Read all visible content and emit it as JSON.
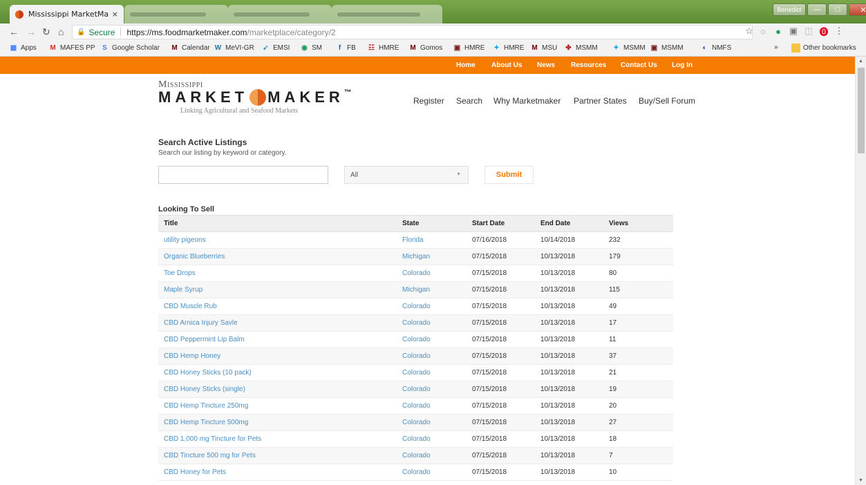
{
  "browser": {
    "active_tab_title": "Mississippi MarketMaker",
    "tab_close": "×",
    "user_button": "Benedict",
    "secure_label": "Secure",
    "url_host": "https://ms.foodmarketmaker.com",
    "url_path": "/marketplace/category/2",
    "bookmarks": [
      {
        "label": "Apps",
        "icon": "apps-grid-icon",
        "color": "#4285f4"
      },
      {
        "label": "MAFES PP",
        "icon": "gmail-icon",
        "color": "#d93025"
      },
      {
        "label": "Google Scholar",
        "icon": "scholar-icon",
        "color": "#4285f4"
      },
      {
        "label": "Calendar",
        "icon": "msu-m-icon",
        "color": "#660000"
      },
      {
        "label": "MeVI-GR",
        "icon": "wordpress-icon",
        "color": "#21759b"
      },
      {
        "label": "EMSI",
        "icon": "emsi-icon",
        "color": "#3aa0c8"
      },
      {
        "label": "SM",
        "icon": "sm-icon",
        "color": "#1a9b5a"
      },
      {
        "label": "FB",
        "icon": "facebook-icon",
        "color": "#3b5998"
      },
      {
        "label": "HMRE",
        "icon": "hmre-icon",
        "color": "#b22222"
      },
      {
        "label": "Gomos",
        "icon": "msu-m-icon",
        "color": "#660000"
      },
      {
        "label": "HMRE",
        "icon": "photo-icon",
        "color": "#7a1f1f"
      },
      {
        "label": "HMRE",
        "icon": "twitter-icon",
        "color": "#1da1f2"
      },
      {
        "label": "MSU",
        "icon": "msu-m-icon",
        "color": "#660000"
      },
      {
        "label": "MSMM",
        "icon": "msmm-icon",
        "color": "#b22222"
      },
      {
        "label": "MSMM",
        "icon": "twitter-icon",
        "color": "#1da1f2"
      },
      {
        "label": "MSMM",
        "icon": "photo-icon",
        "color": "#7a1f1f"
      },
      {
        "label": "NMFS",
        "icon": "noaa-icon",
        "color": "#1f4e9e"
      }
    ],
    "bookmarks_overflow": "»",
    "other_bookmarks": "Other bookmarks"
  },
  "topnav": [
    "Home",
    "About Us",
    "News",
    "Resources",
    "Contact Us",
    "Log In"
  ],
  "logo": {
    "line1": "Mississippi",
    "market": "MARKET",
    "maker": "MAKER",
    "tm": "™",
    "tagline": "Linking Agricultural and Seafood Markets"
  },
  "mainnav": [
    "Register",
    "Search",
    "Why Marketmaker",
    "Partner States",
    "Buy/Sell Forum"
  ],
  "search": {
    "title": "Search Active Listings",
    "subtitle": "Search our listing by keyword or category.",
    "input_value": "",
    "category_selected": "All",
    "submit_label": "Submit"
  },
  "listings": {
    "title": "Looking To Sell",
    "columns": [
      "Title",
      "State",
      "Start Date",
      "End Date",
      "Views"
    ],
    "rows": [
      [
        "utility pigeons",
        "Florida",
        "07/16/2018",
        "10/14/2018",
        "232"
      ],
      [
        "Organic Blueberries",
        "Michigan",
        "07/15/2018",
        "10/13/2018",
        "179"
      ],
      [
        "Toe Drops",
        "Colorado",
        "07/15/2018",
        "10/13/2018",
        "80"
      ],
      [
        "Maple Syrup",
        "Michigan",
        "07/15/2018",
        "10/13/2018",
        "115"
      ],
      [
        "CBD Muscle Rub",
        "Colorado",
        "07/15/2018",
        "10/13/2018",
        "49"
      ],
      [
        "CBD Arnica Injury Savle",
        "Colorado",
        "07/15/2018",
        "10/13/2018",
        "17"
      ],
      [
        "CBD Peppermint Lip Balm",
        "Colorado",
        "07/15/2018",
        "10/13/2018",
        "11"
      ],
      [
        "CBD Hemp Honey",
        "Colorado",
        "07/15/2018",
        "10/13/2018",
        "37"
      ],
      [
        "CBD Honey Sticks (10 pack)",
        "Colorado",
        "07/15/2018",
        "10/13/2018",
        "21"
      ],
      [
        "CBD Honey Sticks (single)",
        "Colorado",
        "07/15/2018",
        "10/13/2018",
        "19"
      ],
      [
        "CBD Hemp Tincture 250mg",
        "Colorado",
        "07/15/2018",
        "10/13/2018",
        "20"
      ],
      [
        "CBD Hemp Tincture 500mg",
        "Colorado",
        "07/15/2018",
        "10/13/2018",
        "27"
      ],
      [
        "CBD 1,000 mg Tincture for Pets",
        "Colorado",
        "07/15/2018",
        "10/13/2018",
        "18"
      ],
      [
        "CBD Tincture 500 mg for Pets",
        "Colorado",
        "07/15/2018",
        "10/13/2018",
        "7"
      ],
      [
        "CBD Honey for Pets",
        "Colorado",
        "07/15/2018",
        "10/13/2018",
        "10"
      ]
    ]
  },
  "colors": {
    "brand_orange": "#f57c00",
    "link_blue": "#4a90c7",
    "chrome_green": "#6b9a3f"
  }
}
